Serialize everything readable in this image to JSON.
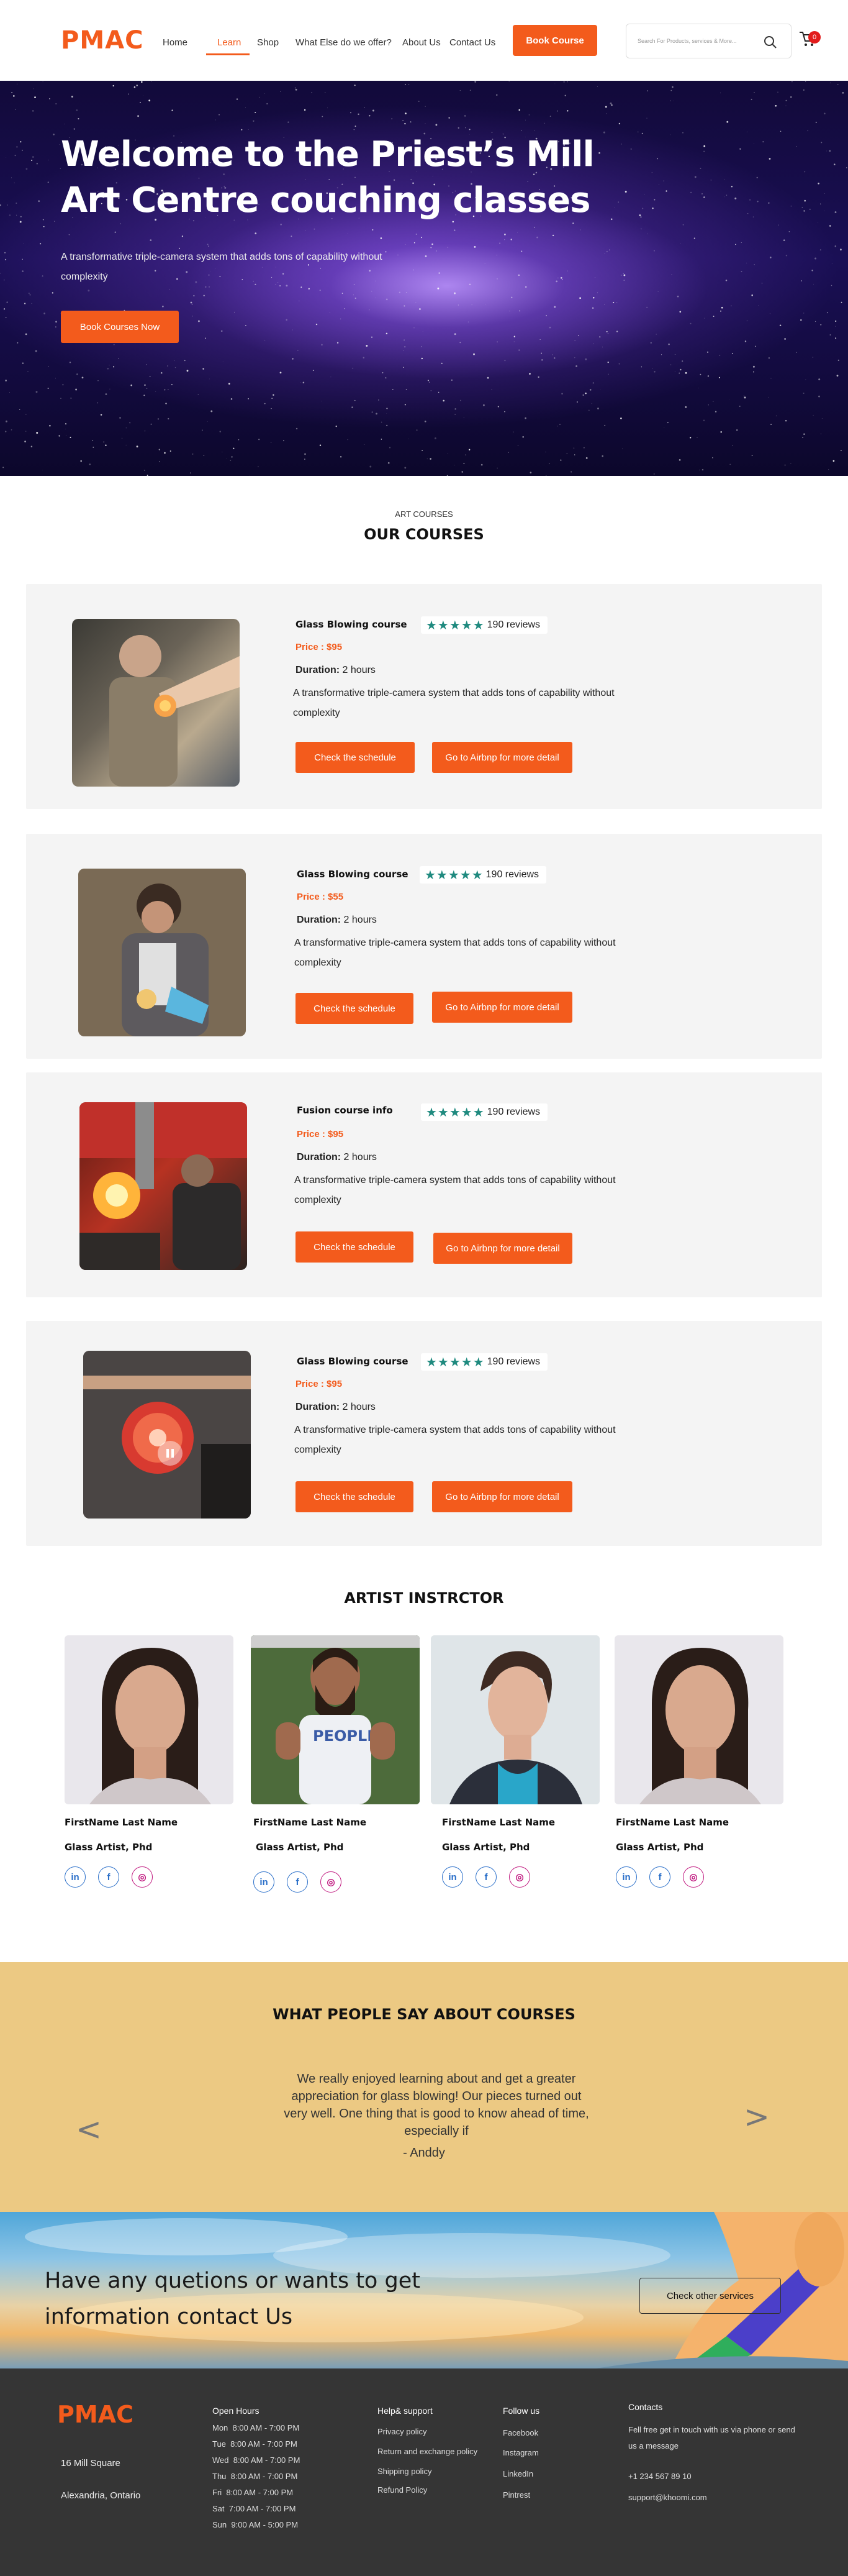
{
  "header": {
    "logo": "PMAC",
    "nav": [
      "Home",
      "Learn",
      "Shop",
      "What Else do we offer?",
      "About Us",
      "Contact Us"
    ],
    "book_button": "Book Course",
    "search_placeholder": "Search For Products, services & More...",
    "cart_count": "0"
  },
  "hero": {
    "title": "Welcome to the Priest’s Mill Art Centre couching classes",
    "subtitle": "A transformative triple-camera system that adds tons of capability without complexity",
    "button": "Book Courses Now"
  },
  "courses": {
    "eyebrow": "ART COURSES",
    "title": "OUR COURSES",
    "items": [
      {
        "name": "Glass Blowing course",
        "stars": "★★★★★",
        "reviews": "190 reviews",
        "price": "Price : $95",
        "duration_label": "Duration:",
        "duration": " 2 hours",
        "desc": "A transformative triple-camera system that adds tons of capability without complexity",
        "btn_schedule": "Check the schedule",
        "btn_airbnb": "Go to Airbnp for more detail"
      },
      {
        "name": "Glass Blowing course",
        "stars": "★★★★★",
        "reviews": "190 reviews",
        "price": "Price : $55",
        "duration_label": "Duration:",
        "duration": " 2 hours",
        "desc": "A transformative triple-camera system that adds tons of capability without complexity",
        "btn_schedule": "Check the schedule",
        "btn_airbnb": "Go to Airbnp for more detail"
      },
      {
        "name": "Fusion course info",
        "stars": "★★★★★",
        "reviews": "190 reviews",
        "price": "Price : $95",
        "duration_label": "Duration:",
        "duration": " 2 hours",
        "desc": "A transformative triple-camera system that adds tons of capability without complexity",
        "btn_schedule": "Check the schedule",
        "btn_airbnb": "Go to Airbnp for more detail"
      },
      {
        "name": "Glass Blowing course",
        "stars": "★★★★★",
        "reviews": "190 reviews",
        "price": "Price : $95",
        "duration_label": "Duration:",
        "duration": " 2 hours",
        "desc": "A transformative triple-camera system that adds tons of capability without complexity",
        "btn_schedule": "Check the schedule",
        "btn_airbnb": "Go to Airbnp for more detail"
      }
    ]
  },
  "instructors": {
    "title": "ARTIST INSTRCTOR",
    "items": [
      {
        "name": "FirstName Last Name",
        "role": "Glass Artist, Phd"
      },
      {
        "name": "FirstName Last Name",
        "role": "Glass Artist, Phd"
      },
      {
        "name": "FirstName Last Name",
        "role": "Glass Artist, Phd"
      },
      {
        "name": "FirstName Last Name",
        "role": "Glass Artist, Phd"
      }
    ],
    "social": {
      "linkedin": "in",
      "facebook": "f",
      "instagram": "◎"
    }
  },
  "testimonials": {
    "title": "WHAT PEOPLE SAY ABOUT COURSES",
    "quote": "We really enjoyed learning about and get a greater appreciation for glass blowing! Our pieces turned out very well. One thing that is good to know ahead of time, especially if",
    "author": "- Anddy",
    "prev": "<",
    "next": ">"
  },
  "contact_banner": {
    "title": "Have any quetions  or  wants to get information contact  Us",
    "button": "Check other services"
  },
  "footer": {
    "logo": "PMAC",
    "address1": "16 Mill Square",
    "address2": "Alexandria, Ontario",
    "hours_title": "Open Hours",
    "hours": [
      {
        "day": "Mon",
        "time": "8:00 AM - 7:00 PM"
      },
      {
        "day": "Tue",
        "time": "8:00 AM - 7:00 PM"
      },
      {
        "day": "Wed",
        "time": "8:00 AM - 7:00 PM"
      },
      {
        "day": "Thu",
        "time": "8:00 AM - 7:00 PM"
      },
      {
        "day": "Fri",
        "time": "8:00 AM - 7:00 PM"
      },
      {
        "day": "Sat",
        "time": "7:00 AM - 7:00 PM"
      },
      {
        "day": "Sun",
        "time": "9:00 AM - 5:00 PM"
      }
    ],
    "help_title": "Help& support",
    "help": [
      "Privacy policy",
      "Return and exchange policy",
      "Shipping policy",
      "Refund Policy"
    ],
    "follow_title": "Follow us",
    "follow": [
      "Facebook",
      "Instagram",
      "LinkedIn",
      "Pintrest"
    ],
    "contacts_title": "Contacts",
    "contacts_text": "Fell free get in touch with us via phone or send us a message",
    "phone": "+1 234 567 89 10",
    "email": "support@khoomi.com"
  },
  "colors": {
    "accent": "#f35b1c",
    "testimonial_bg": "#ecc983",
    "footer_bg": "#353535",
    "star": "#1f8a7f"
  }
}
